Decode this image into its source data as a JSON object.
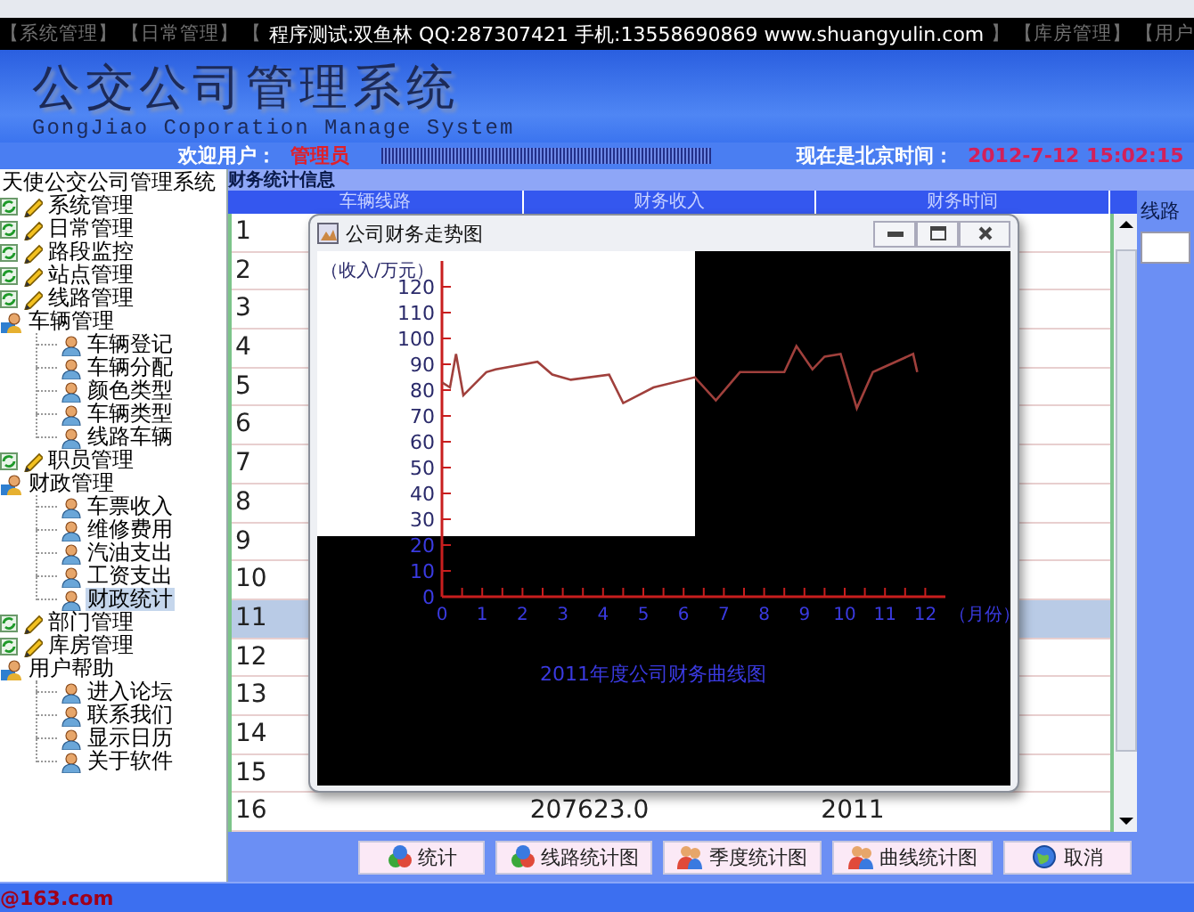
{
  "menu": {
    "left_items": [
      "【系统管理】",
      "【日常管理】",
      "【"
    ],
    "overlay_text": "程序测试:双鱼林 QQ:287307421 手机:13558690869 www.shuangyulin.com",
    "right_items": [
      "】",
      "【库房管理】",
      "【用户"
    ]
  },
  "banner": {
    "title": "公交公司管理系统",
    "subtitle": "GongJiao Coporation Manage System"
  },
  "welcome": {
    "label": "欢迎用户：",
    "user": "管理员",
    "time_label": "现在是北京时间：",
    "time": "2012-7-12 15:02:15"
  },
  "tree": {
    "root": "天使公交公司管理系统",
    "items": [
      {
        "label": "系统管理",
        "kind": "module",
        "expanded": false,
        "selected": false
      },
      {
        "label": "日常管理",
        "kind": "module",
        "expanded": false,
        "selected": false
      },
      {
        "label": "路段监控",
        "kind": "module",
        "expanded": false,
        "selected": false
      },
      {
        "label": "站点管理",
        "kind": "module",
        "expanded": false,
        "selected": false
      },
      {
        "label": "线路管理",
        "kind": "module",
        "expanded": false,
        "selected": false
      },
      {
        "label": "车辆管理",
        "kind": "group",
        "expanded": true,
        "selected": false,
        "children": [
          {
            "label": "车辆登记",
            "selected": false
          },
          {
            "label": "车辆分配",
            "selected": false
          },
          {
            "label": "颜色类型",
            "selected": false
          },
          {
            "label": "车辆类型",
            "selected": false
          },
          {
            "label": "线路车辆",
            "selected": false
          }
        ]
      },
      {
        "label": "职员管理",
        "kind": "module",
        "expanded": false,
        "selected": false
      },
      {
        "label": "财政管理",
        "kind": "group",
        "expanded": true,
        "selected": false,
        "children": [
          {
            "label": "车票收入",
            "selected": false
          },
          {
            "label": "维修费用",
            "selected": false
          },
          {
            "label": "汽油支出",
            "selected": false
          },
          {
            "label": "工资支出",
            "selected": false
          },
          {
            "label": "财政统计",
            "selected": true
          }
        ]
      },
      {
        "label": "部门管理",
        "kind": "module",
        "expanded": false,
        "selected": false
      },
      {
        "label": "库房管理",
        "kind": "module",
        "expanded": false,
        "selected": false
      },
      {
        "label": "用户帮助",
        "kind": "group",
        "expanded": true,
        "selected": false,
        "children": [
          {
            "label": "进入论坛",
            "selected": false
          },
          {
            "label": "联系我们",
            "selected": false
          },
          {
            "label": "显示日历",
            "selected": false
          },
          {
            "label": "关于软件",
            "selected": false
          }
        ]
      }
    ]
  },
  "content": {
    "title": "财务统计信息",
    "table": {
      "columns": [
        "车辆线路",
        "财务收入",
        "财务时间"
      ],
      "rows": [
        {
          "cells": [
            "1"
          ],
          "selected": false
        },
        {
          "cells": [
            "2"
          ],
          "selected": false
        },
        {
          "cells": [
            "3"
          ],
          "selected": false
        },
        {
          "cells": [
            "4"
          ],
          "selected": false
        },
        {
          "cells": [
            "5"
          ],
          "selected": false
        },
        {
          "cells": [
            "6"
          ],
          "selected": false
        },
        {
          "cells": [
            "7"
          ],
          "selected": false
        },
        {
          "cells": [
            "8"
          ],
          "selected": false
        },
        {
          "cells": [
            "9"
          ],
          "selected": false
        },
        {
          "cells": [
            "10"
          ],
          "selected": false
        },
        {
          "cells": [
            "11"
          ],
          "selected": true
        },
        {
          "cells": [
            "12"
          ],
          "selected": false
        },
        {
          "cells": [
            "13"
          ],
          "selected": false
        },
        {
          "cells": [
            "14"
          ],
          "selected": false
        },
        {
          "cells": [
            "15"
          ],
          "selected": false
        },
        {
          "cells": [
            "16",
            "207623.0",
            "2011"
          ],
          "selected": false
        }
      ]
    },
    "side_label": "线路",
    "buttons": [
      {
        "label": "统计",
        "kind": "stat"
      },
      {
        "label": "线路统计图",
        "kind": "stat"
      },
      {
        "label": "季度统计图",
        "kind": "chart"
      },
      {
        "label": "曲线统计图",
        "kind": "chart"
      },
      {
        "label": "取消",
        "kind": "cancel"
      }
    ]
  },
  "dialog": {
    "title": "公司财务走势图",
    "chart_data": {
      "type": "line",
      "title": "2011年度公司财务曲线图",
      "xlabel": "（月份）",
      "ylabel": "（收入/万元）",
      "x": [
        0,
        0.2,
        0.35,
        0.53,
        1.1,
        1.33,
        2.37,
        2.74,
        3.2,
        4.15,
        4.5,
        5.25,
        6.28,
        6.8,
        7.4,
        8.5,
        8.8,
        9.2,
        9.5,
        9.9,
        10.3,
        10.7,
        11.7,
        11.8
      ],
      "series": [
        {
          "color": "#a0403c",
          "values": [
            83,
            81,
            94,
            78,
            87,
            88,
            91,
            86,
            84,
            86,
            75,
            81,
            85,
            76,
            87,
            87,
            97,
            88,
            93,
            94,
            73,
            87,
            94,
            87
          ]
        }
      ],
      "xlim": [
        0,
        12.5
      ],
      "ylim": [
        0,
        130
      ],
      "xticks": [
        0,
        1,
        2,
        3,
        4,
        5,
        6,
        7,
        8,
        9,
        10,
        11,
        12
      ],
      "yticks": [
        0,
        10,
        20,
        30,
        40,
        50,
        60,
        70,
        80,
        90,
        100,
        110,
        120
      ]
    }
  },
  "footer": {
    "text": "@163.com"
  }
}
